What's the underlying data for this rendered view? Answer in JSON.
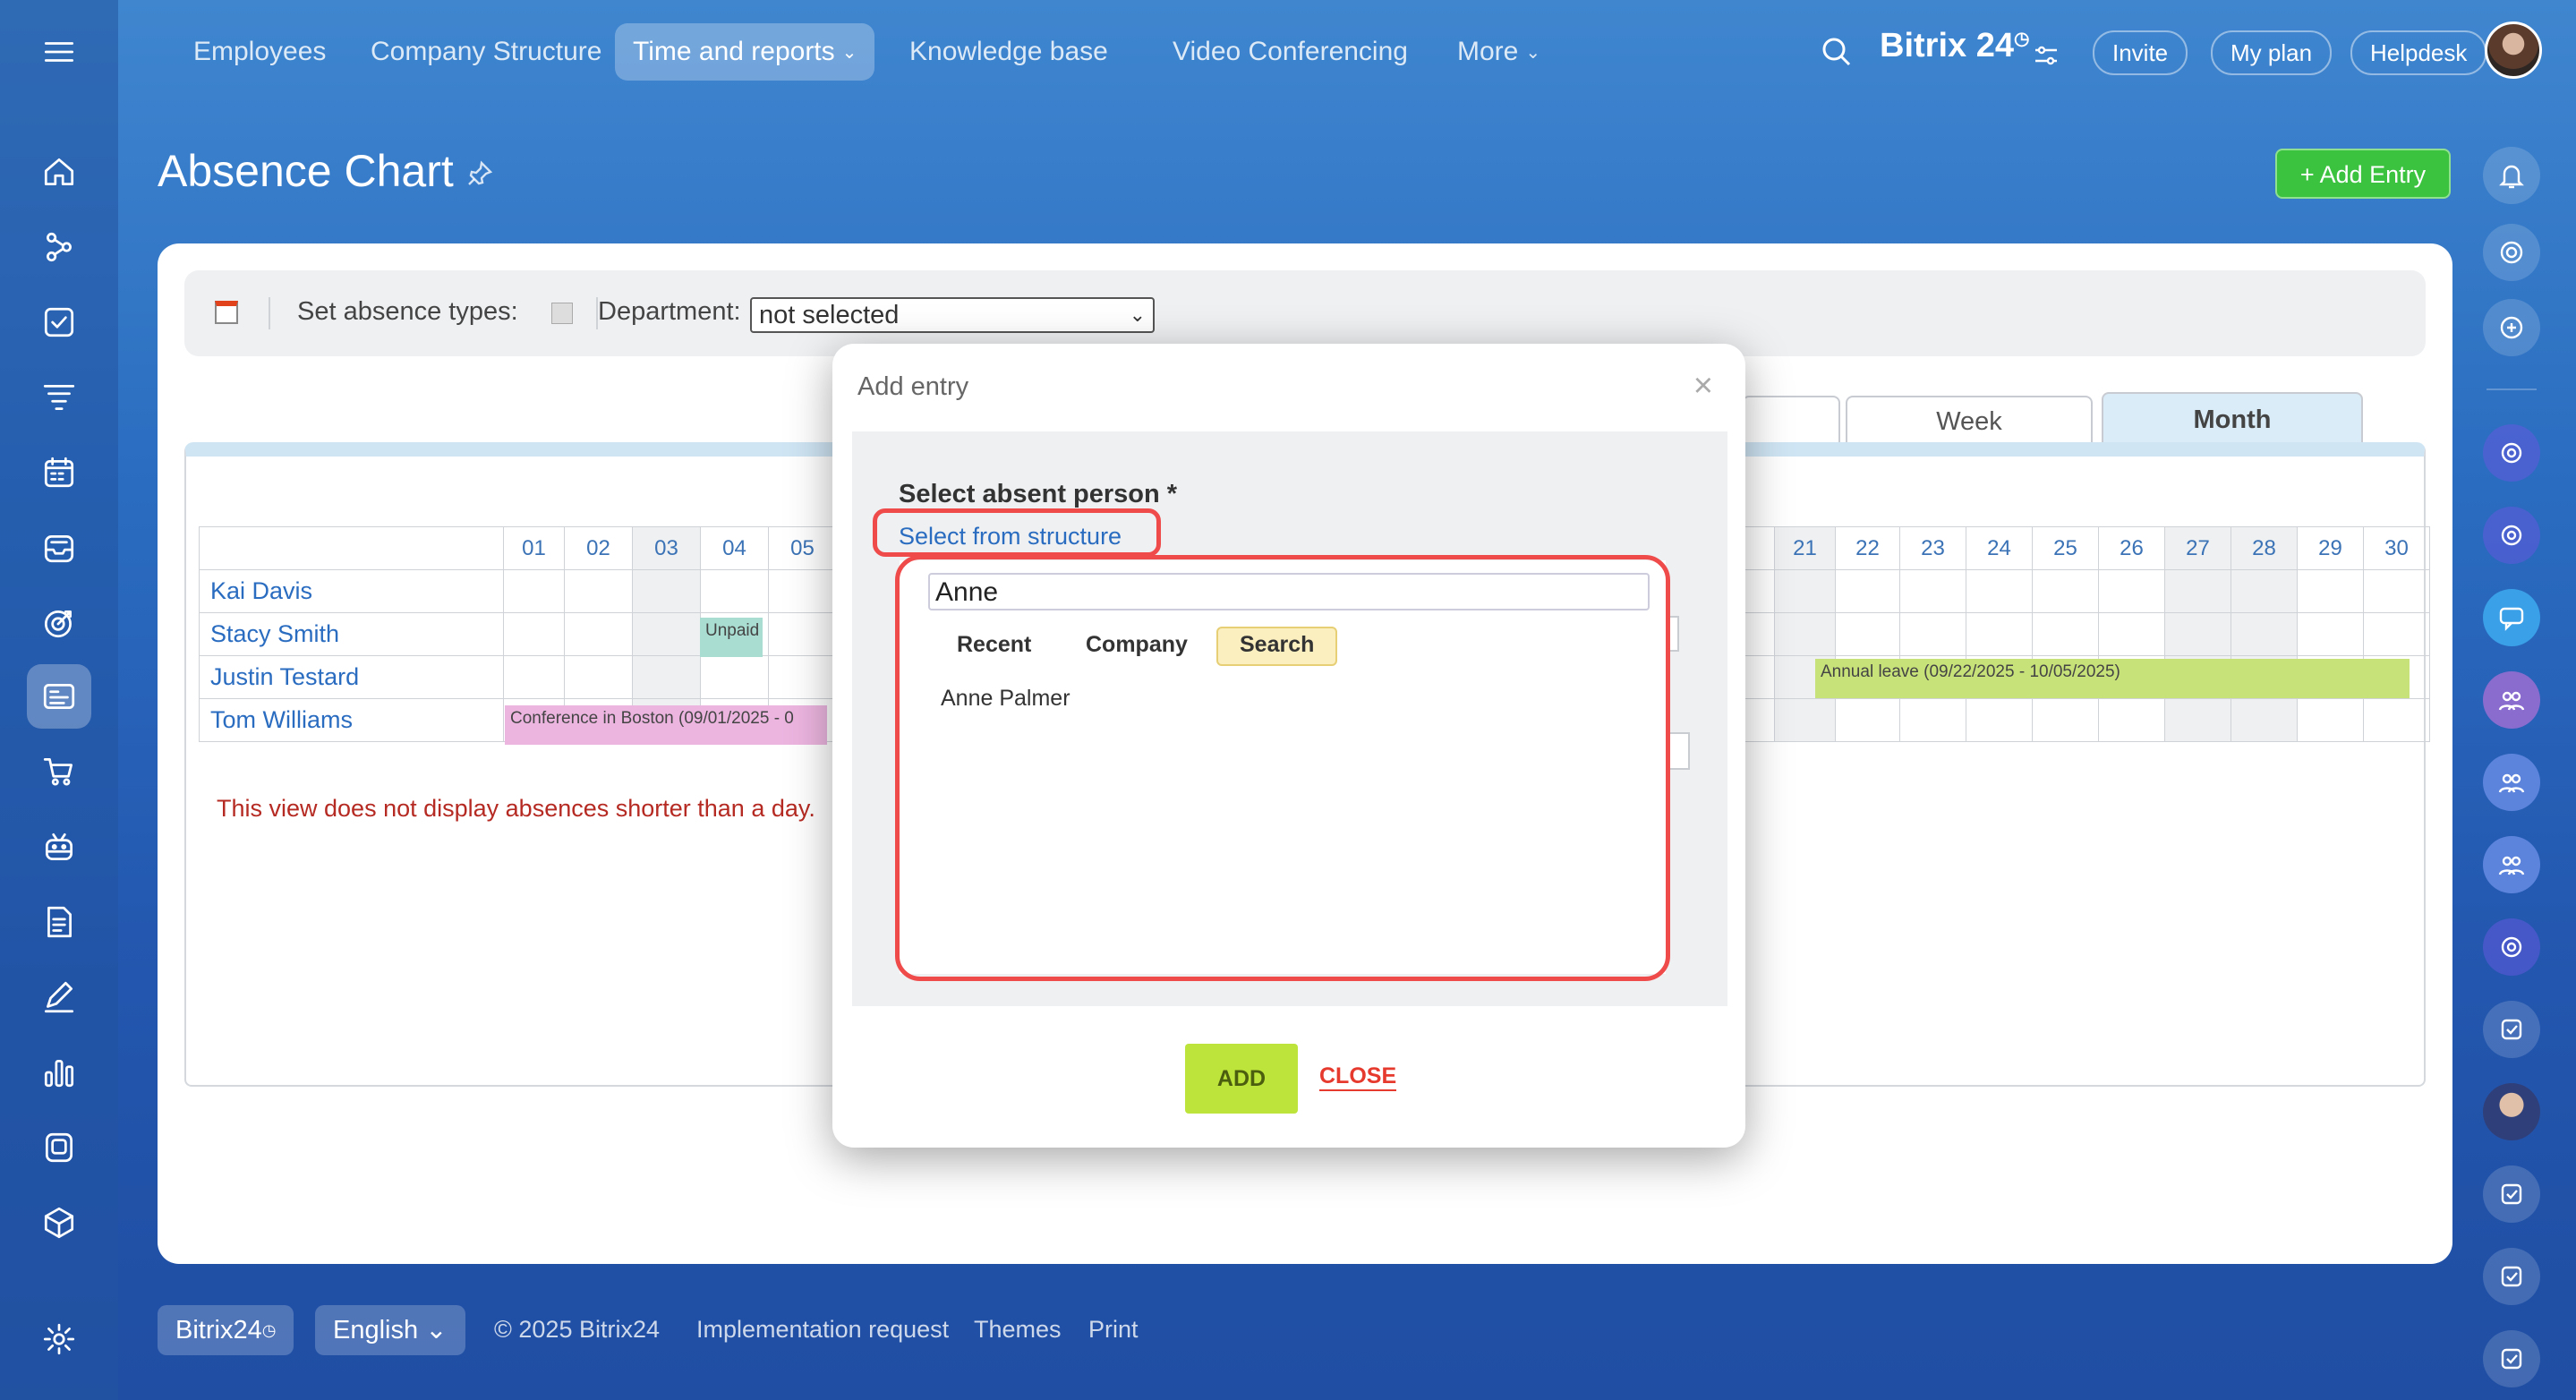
{
  "nav": {
    "items": [
      {
        "label": "Employees"
      },
      {
        "label": "Company Structure"
      },
      {
        "label": "Time and reports"
      },
      {
        "label": "Knowledge base"
      },
      {
        "label": "Video Conferencing"
      },
      {
        "label": "More"
      }
    ],
    "brand": "Bitrix 24",
    "invite": "Invite",
    "my_plan": "My plan",
    "helpdesk": "Helpdesk"
  },
  "page": {
    "title": "Absence Chart",
    "add_entry": "Add Entry"
  },
  "filter": {
    "set_types_label": "Set absence types:",
    "department_label": "Department:",
    "department_value": "not selected"
  },
  "views": {
    "week": "Week",
    "month": "Month"
  },
  "calendar": {
    "days": [
      "01",
      "02",
      "03",
      "04",
      "05",
      "21",
      "22",
      "23",
      "24",
      "25",
      "26",
      "27",
      "28",
      "29",
      "30"
    ],
    "employees": [
      "Kai Davis",
      "Stacy Smith",
      "Justin Testard",
      "Tom Williams"
    ],
    "absences": {
      "unpaid": "Unpaid",
      "conference": "Conference in Boston (09/01/2025 - 0",
      "annual": "Annual leave (09/22/2025 - 10/05/2025)"
    },
    "note": "This view does not display absences shorter than a day."
  },
  "modal": {
    "title": "Add entry",
    "select_label": "Select absent person *",
    "select_link": "Select from structure",
    "search_value": "Anne",
    "tabs": [
      "Recent",
      "Company",
      "Search"
    ],
    "active_tab": "Search",
    "result": "Anne Palmer",
    "add": "ADD",
    "close": "CLOSE"
  },
  "footer": {
    "brand": "Bitrix24",
    "language": "English",
    "copyright": "© 2025 Bitrix24",
    "links": [
      "Implementation request",
      "Themes",
      "Print"
    ]
  },
  "colors": {
    "accent": "#2a6cc0",
    "add_entry_green": "#3bc23f",
    "highlight_red": "#ef4b4b",
    "add_btn_lime": "#bde43a",
    "close_red": "#e63a2e",
    "conference_pink": "#ecb5e0",
    "annual_green": "#c8e27a",
    "unpaid_teal": "#a9ddd2"
  },
  "icons": {
    "left_sidebar": [
      "menu-icon",
      "home-icon",
      "flows-icon",
      "tasks-icon",
      "crm-funnel-icon",
      "calendar-icon",
      "inbox-icon",
      "target-icon",
      "feed-icon",
      "cart-icon",
      "robot-icon",
      "document-icon",
      "sign-icon",
      "analytics-icon",
      "knowledge-icon",
      "box-icon",
      "settings-icon"
    ],
    "right_bar": [
      "bell-icon",
      "copilot-icon",
      "chat-search-icon",
      "chat-avatar-icon",
      "chat-avatar-icon",
      "chat-bubble-icon",
      "group-icon",
      "group-icon",
      "group-icon",
      "chat-avatar-icon",
      "task-chat-icon",
      "user-avatar",
      "task-chat-icon",
      "task-chat-icon",
      "task-chat-icon"
    ]
  }
}
